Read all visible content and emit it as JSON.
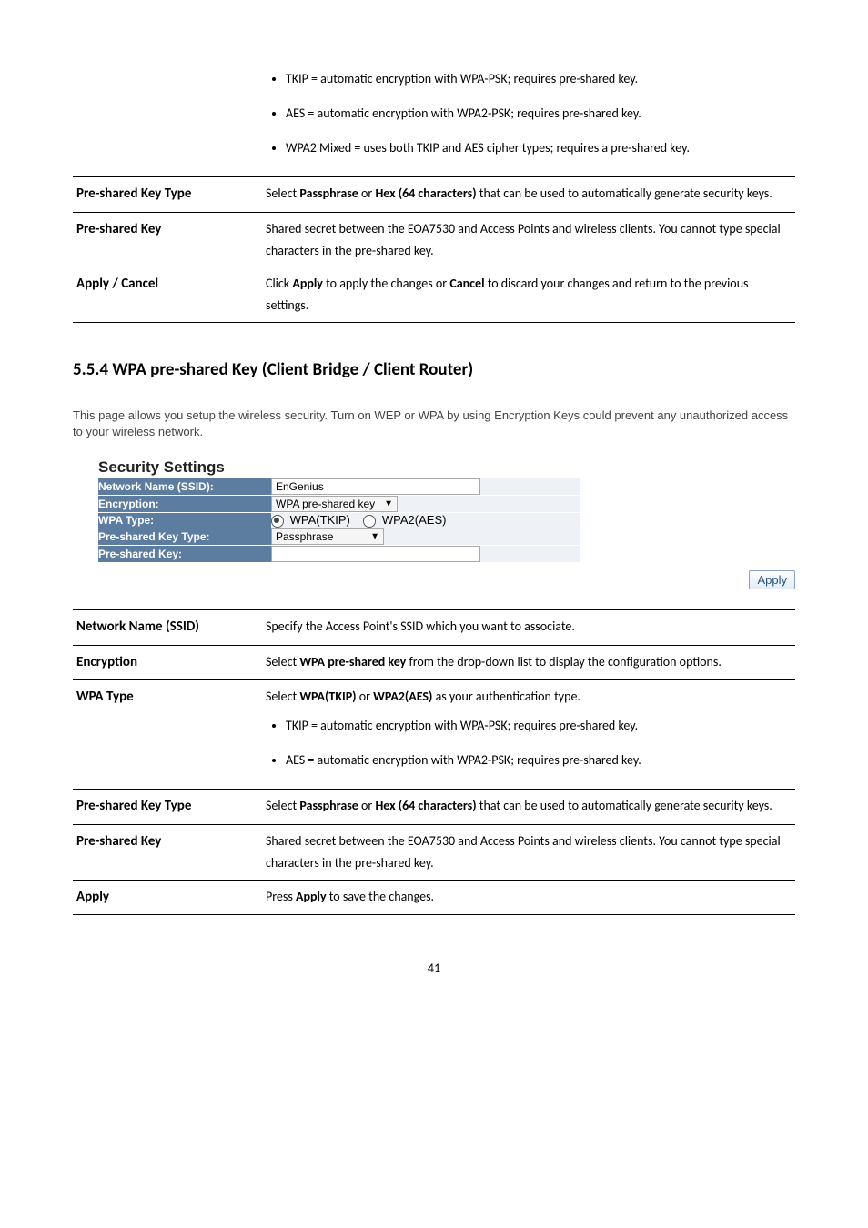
{
  "table1": {
    "bullets": [
      "TKIP = automatic encryption with WPA-PSK; requires pre-shared key.",
      "AES = automatic encryption with WPA2-PSK; requires pre-shared key.",
      "WPA2 Mixed = uses both TKIP and AES cipher types; requires a pre-shared key."
    ],
    "rows": [
      {
        "label": "Pre-shared Key Type",
        "select_before": "Select ",
        "bold1": "Passphrase",
        "mid1": " or ",
        "bold2": "Hex (64 characters)",
        "after": " that can be used to automatically generate security keys."
      },
      {
        "label": "Pre-shared Key",
        "text": "Shared secret between the EOA7530 and Access Points and wireless clients. You cannot type special characters in the pre-shared key."
      },
      {
        "label": "Apply / Cancel",
        "click": "Click ",
        "bold1": "Apply",
        "mid": " to apply the changes or ",
        "bold2": "Cancel",
        "after": " to discard your changes and return to the previous settings."
      }
    ]
  },
  "heading": "5.5.4 WPA pre-shared Key (Client Bridge / Client Router)",
  "intro": "This page allows you setup the wireless security. Turn on WEP or WPA by using Encryption Keys could prevent any unauthorized access to your wireless network.",
  "settings": {
    "title": "Security Settings",
    "ssid_label": "Network Name (SSID):",
    "ssid_value": "EnGenius",
    "enc_label": "Encryption:",
    "enc_value": "WPA pre-shared key",
    "wpatype_label": "WPA Type:",
    "wpatype_opt1": "WPA(TKIP)",
    "wpatype_opt2": "WPA2(AES)",
    "pskt_label": "Pre-shared Key Type:",
    "pskt_value": "Passphrase",
    "psk_label": "Pre-shared Key:",
    "psk_value": ""
  },
  "apply_btn": "Apply",
  "table2": {
    "rows": [
      {
        "label": "Network Name (SSID)",
        "text": "Specify the Access Point's SSID which you want to associate."
      },
      {
        "label": "Encryption",
        "select": "Select ",
        "bold1": "WPA pre-shared key",
        "after": " from the drop-down list to display the configuration options."
      },
      {
        "label": "WPA Type",
        "select": "Select ",
        "bold1": "WPA(TKIP)",
        "mid": " or ",
        "bold2": "WPA2(AES)",
        "after": " as your authentication type.",
        "bullets": [
          "TKIP = automatic encryption with WPA-PSK; requires pre-shared key.",
          "AES = automatic encryption with WPA2-PSK; requires pre-shared key."
        ]
      },
      {
        "label": "Pre-shared Key Type",
        "select": "Select ",
        "bold1": "Passphrase",
        "mid": " or ",
        "bold2": "Hex (64 characters)",
        "after": " that can be used to automatically generate security keys."
      },
      {
        "label": "Pre-shared Key",
        "text": "Shared secret between the EOA7530 and Access Points and wireless clients. You cannot type special characters in the pre-shared key."
      },
      {
        "label": "Apply",
        "press": "Press ",
        "bold1": "Apply",
        "after": " to save the changes."
      }
    ]
  },
  "page_number": "41"
}
